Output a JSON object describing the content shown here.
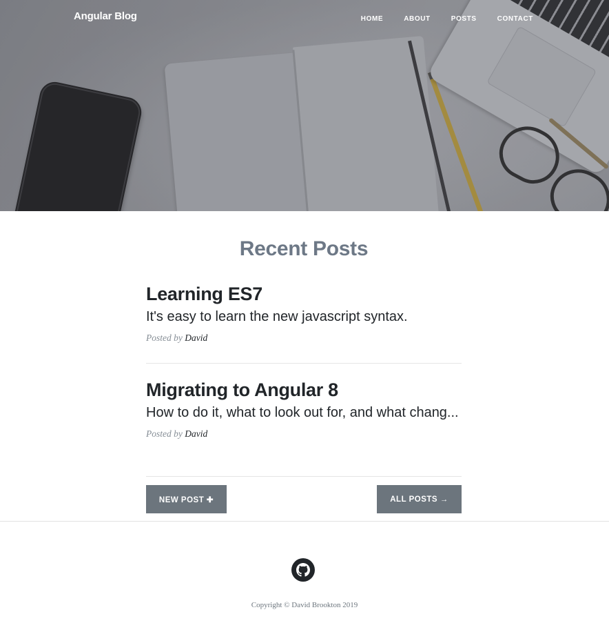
{
  "navbar": {
    "brand": "Angular Blog",
    "links": [
      "HOME",
      "ABOUT",
      "POSTS",
      "CONTACT"
    ]
  },
  "main": {
    "section_title": "Recent Posts",
    "posts": [
      {
        "title": "Learning ES7",
        "subtitle": "It's easy to learn the new javascript syntax.",
        "meta_prefix": "Posted by",
        "author": "David"
      },
      {
        "title": "Migrating to Angular 8",
        "subtitle": "How to do it, what to look out for, and what chang...",
        "meta_prefix": "Posted by",
        "author": "David"
      }
    ],
    "new_post_button": "NEW POST ✚",
    "all_posts_button": "ALL POSTS →"
  },
  "footer": {
    "icon": "github-icon",
    "copyright": "Copyright © David Brookton 2019"
  },
  "colors": {
    "section_title": "#6d7886",
    "button_bg": "#6c757d",
    "text": "#212529",
    "meta": "#868e96"
  }
}
